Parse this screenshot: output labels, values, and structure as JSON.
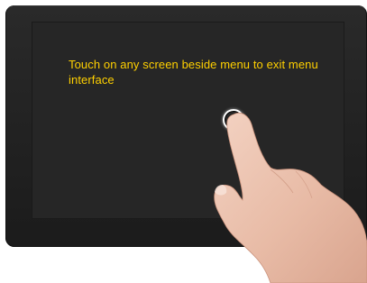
{
  "screen": {
    "instruction": "Touch on any screen beside menu to exit menu interface"
  },
  "icons": {
    "touch": "touch-point-icon",
    "hand": "pointing-hand-icon"
  },
  "colors": {
    "instruction_text": "#ffd000",
    "bezel": "#1f1f1f",
    "screen_bg": "#262626"
  }
}
